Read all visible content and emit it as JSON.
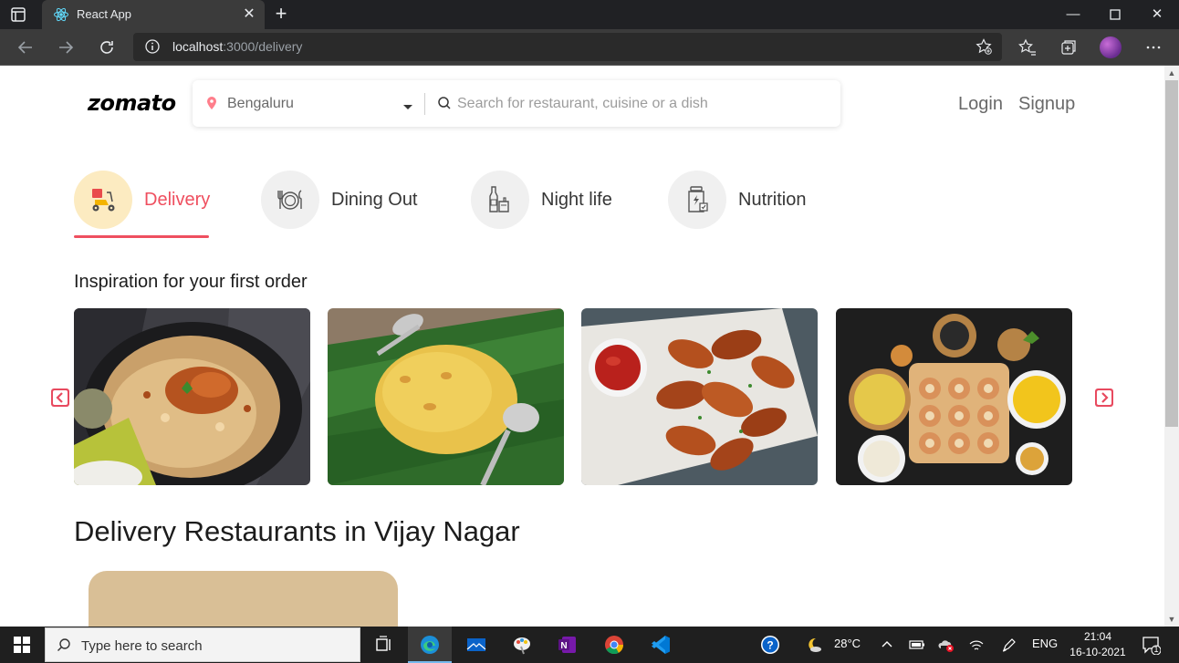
{
  "browser": {
    "tab_title": "React App",
    "url_host": "localhost",
    "url_rest": ":3000/delivery"
  },
  "header": {
    "logo": "zomato",
    "location": "Bengaluru",
    "search_placeholder": "Search for restaurant, cuisine or a dish",
    "login": "Login",
    "signup": "Signup"
  },
  "categories": [
    {
      "label": "Delivery",
      "icon": "scooter-icon",
      "active": true
    },
    {
      "label": "Dining Out",
      "icon": "dining-icon",
      "active": false
    },
    {
      "label": "Night life",
      "icon": "bottles-icon",
      "active": false
    },
    {
      "label": "Nutrition",
      "icon": "supplement-jar-icon",
      "active": false
    }
  ],
  "inspiration": {
    "title": "Inspiration for your first order",
    "items": [
      "biryani-image",
      "kesari-bath-image",
      "chicken-wings-image",
      "pani-puri-image"
    ]
  },
  "restaurants": {
    "heading": "Delivery Restaurants in Vijay Nagar"
  },
  "taskbar": {
    "search_placeholder": "Type here to search",
    "temperature": "28°C",
    "language": "ENG",
    "time": "21:04",
    "date": "16-10-2021",
    "notification_count": "1"
  },
  "colors": {
    "brand_red": "#ef4f5f",
    "active_circle": "#fcebc1",
    "card_beige": "#d9bf96"
  }
}
